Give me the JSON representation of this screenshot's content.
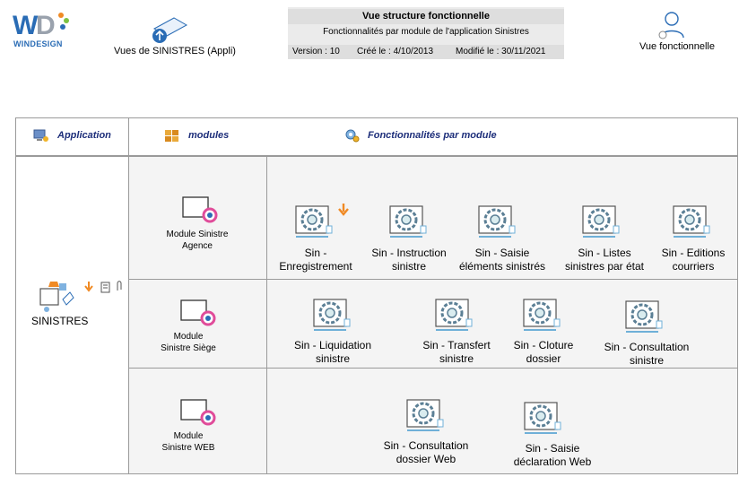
{
  "header": {
    "logo_text": "WINDESIGN",
    "app_view_label": "Vues de SINISTRES (Appli)",
    "info_title": "Vue structure fonctionnelle",
    "info_subtitle": "Fonctionnalités par module de l'application Sinistres",
    "version": "Version : 10",
    "created": "Créé le : 4/10/2013",
    "modified": "Modifié le : 30/11/2021",
    "func_view_label": "Vue fonctionnelle"
  },
  "columns": {
    "application": "Application",
    "modules": "modules",
    "features": "Fonctionnalités par module"
  },
  "application": {
    "name": "SINISTRES"
  },
  "modules": [
    {
      "label_line1": "Module Sinistre",
      "label_line2": "Agence",
      "features": [
        {
          "line1": "Sin -",
          "line2": "Enregistrement"
        },
        {
          "line1": "Sin - Instruction",
          "line2": "sinistre"
        },
        {
          "line1": "Sin - Saisie",
          "line2": "éléments sinistrés"
        },
        {
          "line1": "Sin - Listes",
          "line2": "sinistres par état"
        },
        {
          "line1": "Sin - Editions",
          "line2": "courriers"
        }
      ]
    },
    {
      "label_line1": "Module",
      "label_line2": "Sinistre Siège",
      "features": [
        {
          "line1": "Sin - Liquidation",
          "line2": "sinistre"
        },
        {
          "line1": "Sin - Transfert",
          "line2": "sinistre"
        },
        {
          "line1": "Sin - Cloture",
          "line2": "dossier"
        },
        {
          "line1": "Sin - Consultation",
          "line2": "sinistre"
        }
      ]
    },
    {
      "label_line1": "Module",
      "label_line2": "Sinistre WEB",
      "features": [
        {
          "line1": "Sin - Consultation",
          "line2": "dossier Web"
        },
        {
          "line1": "Sin - Saisie",
          "line2": "déclaration Web"
        }
      ]
    }
  ],
  "colors": {
    "header_text": "#1d2e7a",
    "grid": "#9a9a9a",
    "cell_background": "#f4f4f4",
    "accent_orange": "#f08a24",
    "accent_blue": "#2a6cb5"
  }
}
